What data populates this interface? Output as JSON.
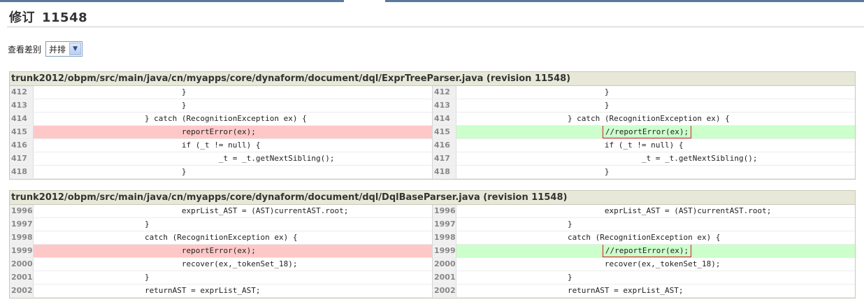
{
  "page": {
    "title_prefix": "修订",
    "revision": "11548",
    "view_label": "查看差别",
    "view_mode": "并排"
  },
  "diffs": [
    {
      "file": "trunk2012/obpm/src/main/java/cn/myapps/core/dynaform/document/dql/ExprTreeParser.java (revision 11548)",
      "left": [
        {
          "ln": "412",
          "code": "                                }",
          "type": "ctx"
        },
        {
          "ln": "413",
          "code": "                                }",
          "type": "ctx"
        },
        {
          "ln": "414",
          "code": "                        } catch (RecognitionException ex) {",
          "type": "ctx"
        },
        {
          "ln": "415",
          "code": "                                reportError(ex);",
          "type": "del"
        },
        {
          "ln": "416",
          "code": "                                if (_t != null) {",
          "type": "ctx"
        },
        {
          "ln": "417",
          "code": "                                        _t = _t.getNextSibling();",
          "type": "ctx"
        },
        {
          "ln": "418",
          "code": "                                }",
          "type": "ctx"
        }
      ],
      "right": [
        {
          "ln": "412",
          "code": "                                }",
          "type": "ctx"
        },
        {
          "ln": "413",
          "code": "                                }",
          "type": "ctx"
        },
        {
          "ln": "414",
          "code": "                        } catch (RecognitionException ex) {",
          "type": "ctx"
        },
        {
          "ln": "415",
          "pre": "                                ",
          "code": "//reportError(ex);",
          "type": "add",
          "highlight": true
        },
        {
          "ln": "416",
          "code": "                                if (_t != null) {",
          "type": "ctx"
        },
        {
          "ln": "417",
          "code": "                                        _t = _t.getNextSibling();",
          "type": "ctx"
        },
        {
          "ln": "418",
          "code": "                                }",
          "type": "ctx"
        }
      ]
    },
    {
      "file": "trunk2012/obpm/src/main/java/cn/myapps/core/dynaform/document/dql/DqlBaseParser.java (revision 11548)",
      "left": [
        {
          "ln": "1996",
          "code": "                                exprList_AST = (AST)currentAST.root;",
          "type": "ctx"
        },
        {
          "ln": "1997",
          "code": "                        }",
          "type": "ctx"
        },
        {
          "ln": "1998",
          "code": "                        catch (RecognitionException ex) {",
          "type": "ctx"
        },
        {
          "ln": "1999",
          "code": "                                reportError(ex);",
          "type": "del"
        },
        {
          "ln": "2000",
          "code": "                                recover(ex,_tokenSet_18);",
          "type": "ctx"
        },
        {
          "ln": "2001",
          "code": "                        }",
          "type": "ctx"
        },
        {
          "ln": "2002",
          "code": "                        returnAST = exprList_AST;",
          "type": "ctx"
        }
      ],
      "right": [
        {
          "ln": "1996",
          "code": "                                exprList_AST = (AST)currentAST.root;",
          "type": "ctx"
        },
        {
          "ln": "1997",
          "code": "                        }",
          "type": "ctx"
        },
        {
          "ln": "1998",
          "code": "                        catch (RecognitionException ex) {",
          "type": "ctx"
        },
        {
          "ln": "1999",
          "pre": "                                ",
          "code": "//reportError(ex);",
          "type": "add",
          "highlight": true
        },
        {
          "ln": "2000",
          "code": "                                recover(ex,_tokenSet_18);",
          "type": "ctx"
        },
        {
          "ln": "2001",
          "code": "                        }",
          "type": "ctx"
        },
        {
          "ln": "2002",
          "code": "                        returnAST = exprList_AST;",
          "type": "ctx"
        }
      ]
    }
  ]
}
